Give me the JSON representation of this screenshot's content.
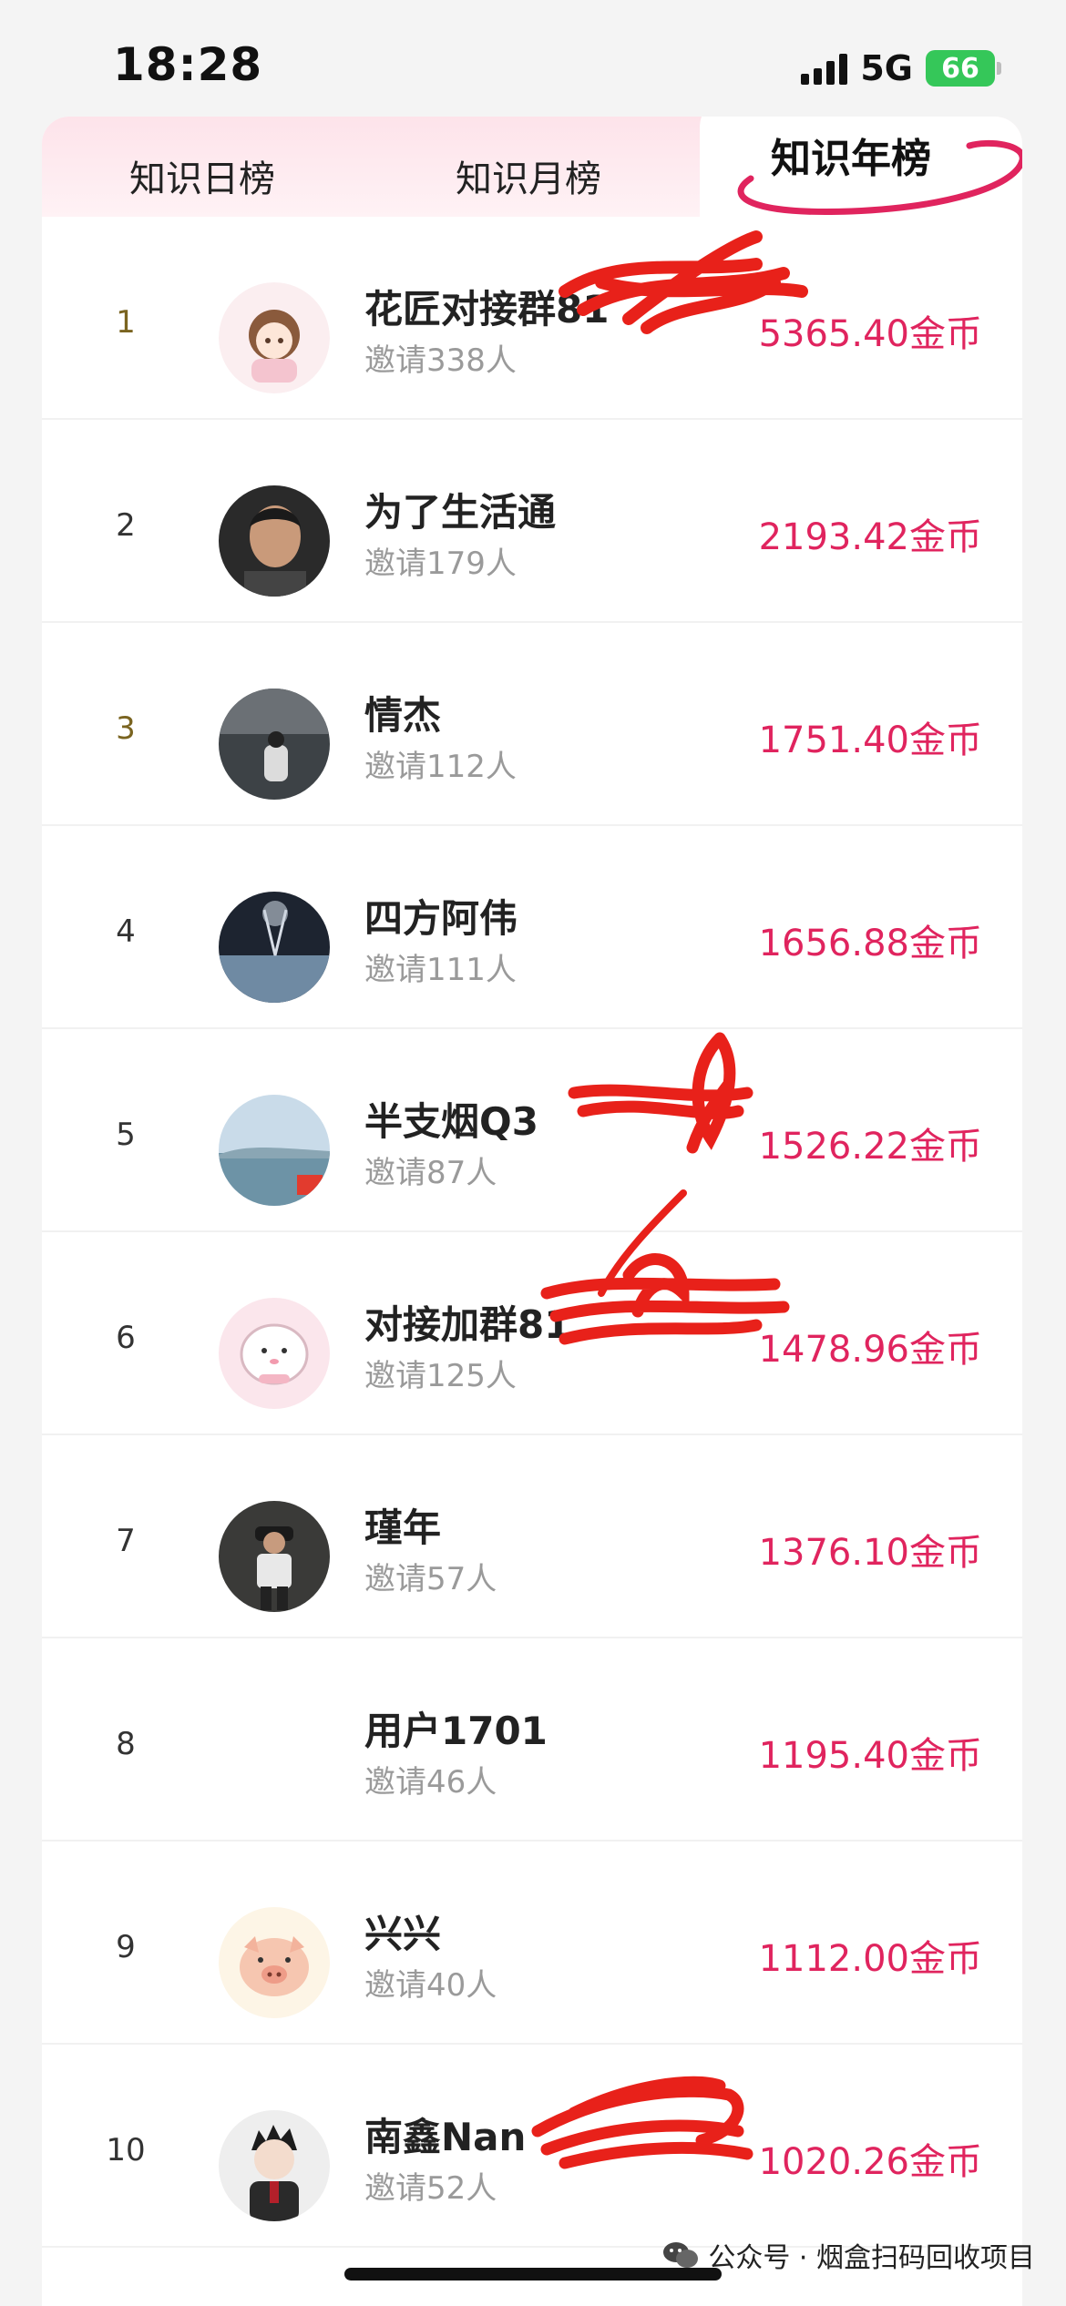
{
  "status_bar": {
    "time": "18:28",
    "network": "5G",
    "battery": "66"
  },
  "tabs": {
    "daily": "知识日榜",
    "monthly": "知识月榜",
    "yearly": "知识年榜",
    "active": "yearly"
  },
  "ranking": [
    {
      "rank": "1",
      "name": "花匠对接群81",
      "invite": "邀请338人",
      "amount": "5365.40金币"
    },
    {
      "rank": "2",
      "name": "为了生活通",
      "invite": "邀请179人",
      "amount": "2193.42金币"
    },
    {
      "rank": "3",
      "name": "情杰",
      "invite": "邀请112人",
      "amount": "1751.40金币"
    },
    {
      "rank": "4",
      "name": "四方阿伟",
      "invite": "邀请111人",
      "amount": "1656.88金币"
    },
    {
      "rank": "5",
      "name": "半支烟Q3",
      "invite": "邀请87人",
      "amount": "1526.22金币"
    },
    {
      "rank": "6",
      "name": "对接加群81",
      "invite": "邀请125人",
      "amount": "1478.96金币"
    },
    {
      "rank": "7",
      "name": "瑾年",
      "invite": "邀请57人",
      "amount": "1376.10金币"
    },
    {
      "rank": "8",
      "name": "用户1701",
      "invite": "邀请46人",
      "amount": "1195.40金币"
    },
    {
      "rank": "9",
      "name": "兴兴",
      "invite": "邀请40人",
      "amount": "1112.00金币"
    },
    {
      "rank": "10",
      "name": "南鑫Nan",
      "invite": "邀请52人",
      "amount": "1020.26金币"
    }
  ],
  "watermark": "公众号 · 烟盒扫码回收项目",
  "colors": {
    "amount": "#e0245e",
    "tab_bg": "#fde3ea",
    "underline": "#e0245e",
    "redaction": "#e8211a"
  }
}
